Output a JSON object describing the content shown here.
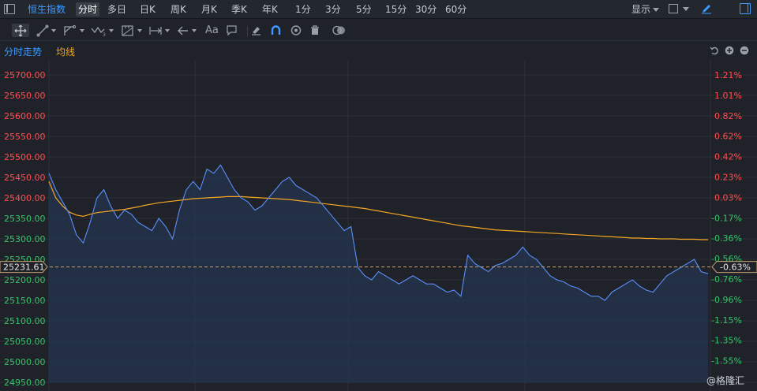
{
  "toolbar_top": {
    "symbol": "恒生指数",
    "timeframes": [
      "分时",
      "多日",
      "日K",
      "周K",
      "月K",
      "季K",
      "年K",
      "1分",
      "3分",
      "5分",
      "15分",
      "30分",
      "60分"
    ],
    "active_timeframe": "分时",
    "display_label": "显示"
  },
  "drawing_tools": {
    "text_tool_label": "Aa"
  },
  "chart_header": {
    "title": "分时走势",
    "ma_label": "均线"
  },
  "colors": {
    "price_line": "#5b8ff9",
    "average_line": "#f5a623",
    "axis_up": "#ff4d4f",
    "axis_down": "#36c36a",
    "accent": "#3d9bff"
  },
  "current_price": {
    "value": "25231.61",
    "change": "-0.63%"
  },
  "watermark": "@格隆汇",
  "chart_data": {
    "type": "line",
    "title": "分时走势",
    "y_left_ticks": [
      "25700.00",
      "25650.00",
      "25600.00",
      "25550.00",
      "25500.00",
      "25450.00",
      "25400.00",
      "25350.00",
      "25300.00",
      "25250.00",
      "25200.00",
      "25150.00",
      "25100.00",
      "25050.00",
      "25000.00",
      "24950.00"
    ],
    "y_right_ticks": [
      "1.21%",
      "1.01%",
      "0.82%",
      "0.62%",
      "0.42%",
      "0.23%",
      "0.03%",
      "-0.17%",
      "-0.36%",
      "-0.56%",
      "-0.76%",
      "-0.96%",
      "-1.15%",
      "-1.35%",
      "-1.55%"
    ],
    "ylim": [
      24950,
      25700
    ],
    "grid": true,
    "series": [
      {
        "name": "price",
        "values": [
          25460,
          25420,
          25390,
          25360,
          25310,
          25290,
          25340,
          25400,
          25420,
          25380,
          25350,
          25370,
          25360,
          25340,
          25330,
          25320,
          25350,
          25330,
          25300,
          25370,
          25420,
          25440,
          25420,
          25470,
          25460,
          25480,
          25450,
          25420,
          25400,
          25390,
          25370,
          25380,
          25400,
          25420,
          25440,
          25450,
          25430,
          25420,
          25410,
          25400,
          25380,
          25360,
          25340,
          25320,
          25330,
          25230,
          25210,
          25200,
          25220,
          25210,
          25200,
          25190,
          25200,
          25210,
          25200,
          25190,
          25190,
          25180,
          25170,
          25175,
          25160,
          25260,
          25240,
          25230,
          25220,
          25235,
          25240,
          25250,
          25260,
          25280,
          25260,
          25250,
          25230,
          25210,
          25200,
          25195,
          25185,
          25180,
          25170,
          25160,
          25160,
          25150,
          25170,
          25180,
          25190,
          25200,
          25185,
          25175,
          25170,
          25190,
          25210,
          25220,
          25230,
          25240,
          25250,
          25220,
          25215
        ]
      },
      {
        "name": "average",
        "values": [
          25440,
          25400,
          25380,
          25365,
          25358,
          25355,
          25360,
          25364,
          25366,
          25368,
          25370,
          25372,
          25375,
          25378,
          25382,
          25385,
          25388,
          25390,
          25392,
          25394,
          25396,
          25398,
          25399,
          25400,
          25401,
          25402,
          25403,
          25403,
          25403,
          25402,
          25401,
          25400,
          25399,
          25398,
          25397,
          25396,
          25394,
          25392,
          25390,
          25388,
          25386,
          25384,
          25382,
          25380,
          25378,
          25376,
          25374,
          25371,
          25368,
          25365,
          25362,
          25359,
          25356,
          25353,
          25350,
          25347,
          25344,
          25341,
          25338,
          25335,
          25332,
          25330,
          25328,
          25326,
          25324,
          25322,
          25321,
          25320,
          25319,
          25318,
          25317,
          25316,
          25315,
          25314,
          25313,
          25312,
          25311,
          25310,
          25309,
          25308,
          25307,
          25306,
          25305,
          25304,
          25303,
          25302,
          25302,
          25301,
          25301,
          25300,
          25300,
          25300,
          25299,
          25299,
          25299,
          25298,
          25298
        ]
      }
    ]
  }
}
